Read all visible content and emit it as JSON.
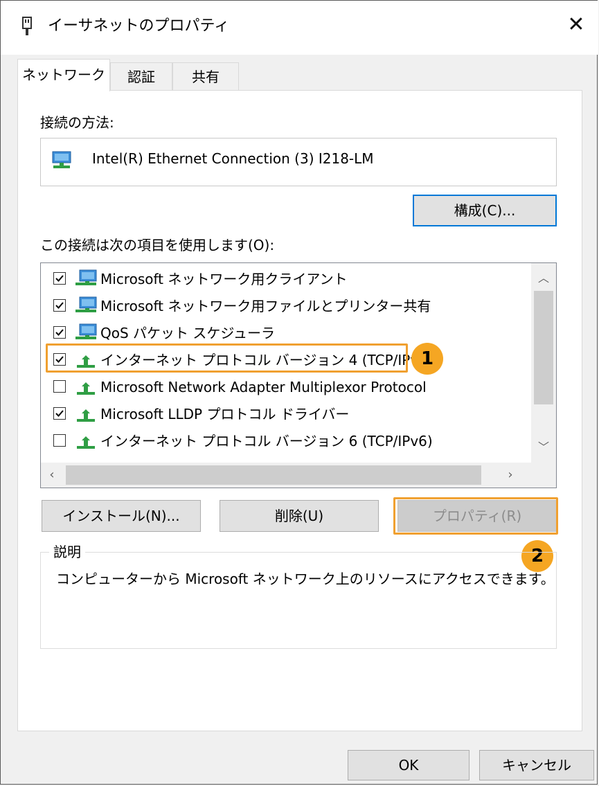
{
  "window": {
    "title": "イーサネットのプロパティ",
    "close_glyph": "✕"
  },
  "tabs": [
    {
      "label": "ネットワーク",
      "active": true
    },
    {
      "label": "認証",
      "active": false
    },
    {
      "label": "共有",
      "active": false
    }
  ],
  "connection": {
    "label": "接続の方法:",
    "adapter_name": "Intel(R) Ethernet Connection (3) I218-LM",
    "configure_button": "構成(C)..."
  },
  "items_label": "この接続は次の項目を使用します(O):",
  "items": [
    {
      "label": "Microsoft ネットワーク用クライアント",
      "checked": true,
      "icon": "network-client-icon"
    },
    {
      "label": "Microsoft ネットワーク用ファイルとプリンター共有",
      "checked": true,
      "icon": "network-client-icon"
    },
    {
      "label": "QoS パケット スケジューラ",
      "checked": true,
      "icon": "network-client-icon"
    },
    {
      "label": "インターネット プロトコル バージョン 4 (TCP/IPv4)",
      "checked": true,
      "icon": "protocol-icon"
    },
    {
      "label": "Microsoft Network Adapter Multiplexor Protocol",
      "checked": false,
      "icon": "protocol-icon"
    },
    {
      "label": "Microsoft LLDP プロトコル ドライバー",
      "checked": true,
      "icon": "protocol-icon"
    },
    {
      "label": "インターネット プロトコル バージョン 6 (TCP/IPv6)",
      "checked": false,
      "icon": "protocol-icon"
    }
  ],
  "buttons": {
    "install": "インストール(N)...",
    "uninstall": "削除(U)",
    "properties": "プロパティ(R)",
    "ok": "OK",
    "cancel": "キャンセル"
  },
  "description": {
    "legend": "説明",
    "text": "コンピューターから Microsoft ネットワーク上のリソースにアクセスできます。"
  },
  "annotations": {
    "badge1": "1",
    "badge2": "2",
    "highlight_color": "#f0a030",
    "badge_color": "#f5a623"
  },
  "colors": {
    "accent": "#0078d7"
  }
}
